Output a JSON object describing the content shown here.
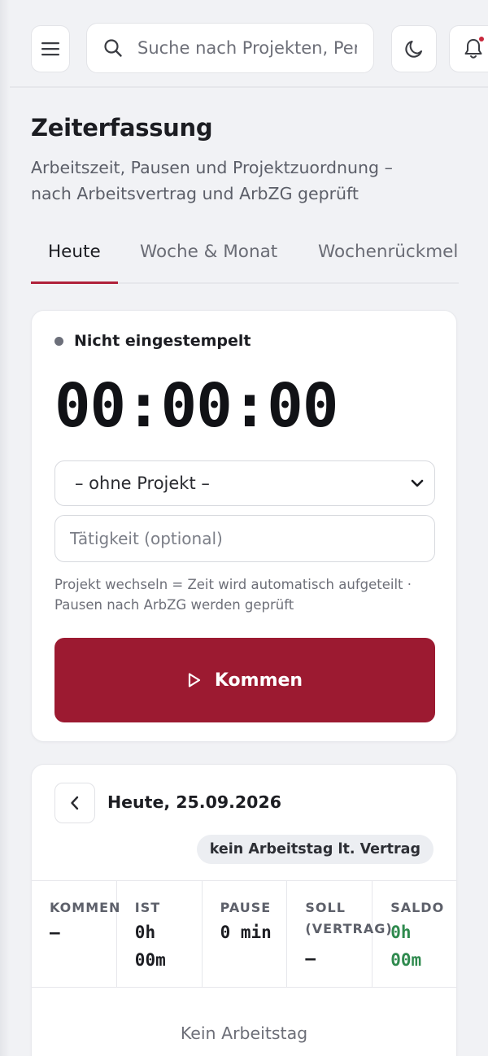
{
  "header": {
    "search_placeholder": "Suche nach Projekten, Personen",
    "icons": [
      "menu-icon",
      "search-icon",
      "moon-icon",
      "bell-icon"
    ]
  },
  "page": {
    "title": "Zeiterfassung",
    "subtitle": "Arbeitszeit, Pausen und Projektzuordnung – nach Arbeitsvertrag und ArbZG geprüft"
  },
  "tabs": [
    {
      "label": "Heute",
      "active": true
    },
    {
      "label": "Woche & Monat",
      "active": false
    },
    {
      "label": "Wochenrückmel",
      "active": false
    }
  ],
  "clock": {
    "status": "Nicht eingestempelt",
    "timer": "00:00:00",
    "project_select": "– ohne Projekt –",
    "activity_placeholder": "Tätigkeit (optional)",
    "hint": "Projekt wechseln = Zeit wird automatisch aufgeteilt · Pausen nach ArbZG werden geprüft",
    "button_label": "Kommen"
  },
  "day": {
    "title": "Heute, 25.09.2026",
    "badge": "kein Arbeitstag lt. Vertrag",
    "stats": [
      {
        "label": "KOMMEN",
        "value": "–"
      },
      {
        "label": "IST",
        "value": "0h 00m"
      },
      {
        "label": "PAUSE",
        "value": "0 min"
      },
      {
        "label": "SOLL (VERTRAG)",
        "value": "–"
      },
      {
        "label": "SALDO",
        "value": "0h 00m"
      }
    ],
    "empty": "Kein Arbeitstag"
  },
  "colors": {
    "accent": "#9c1a31",
    "saldo": "#2f8a4e",
    "status_dot": "#6c6f7a"
  }
}
